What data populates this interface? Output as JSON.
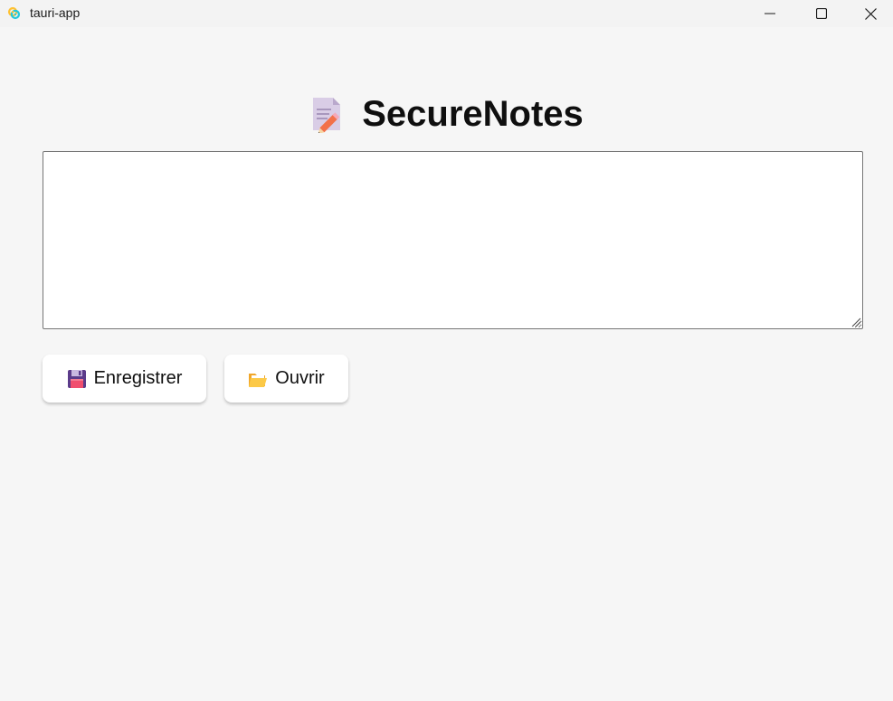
{
  "window": {
    "title": "tauri-app",
    "icon": "tauri-icon",
    "controls": [
      "minimize-icon",
      "maximize-icon",
      "close-icon"
    ]
  },
  "header": {
    "title": "SecureNotes",
    "icon": "memo-icon"
  },
  "editor": {
    "value": "",
    "placeholder": ""
  },
  "actions": {
    "save_label": "Enregistrer",
    "save_icon": "floppy-disk-icon",
    "open_label": "Ouvrir",
    "open_icon": "open-folder-icon"
  },
  "colors": {
    "background": "#f6f6f6",
    "titlebar": "#f3f3f3",
    "button_bg": "#ffffff",
    "text": "#0f0f0f"
  }
}
